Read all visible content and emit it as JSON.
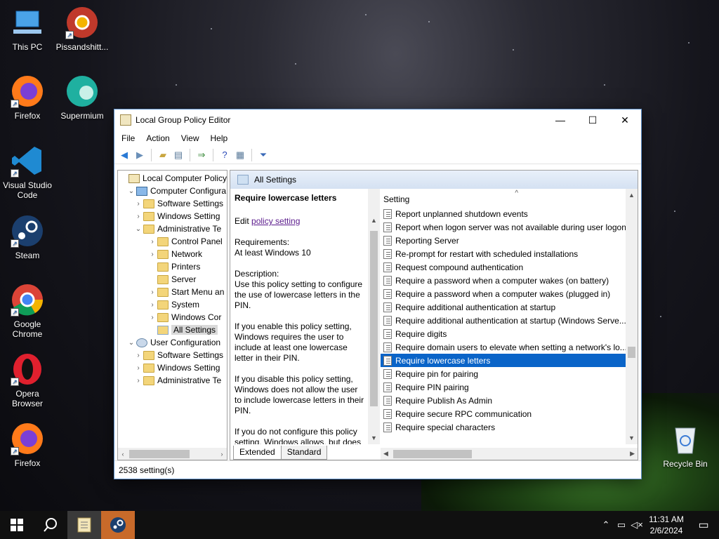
{
  "desktop": {
    "icons": [
      {
        "label": "This PC",
        "icon": "computer-icon"
      },
      {
        "label": "Pissandshitt...",
        "icon": "chrome-canary-icon"
      },
      {
        "label": "Firefox",
        "icon": "firefox-icon"
      },
      {
        "label": "Supermium",
        "icon": "supermium-icon"
      },
      {
        "label": "Visual Studio Code",
        "icon": "vscode-icon"
      },
      {
        "label": "Steam",
        "icon": "steam-icon"
      },
      {
        "label": "Google Chrome",
        "icon": "chrome-icon"
      },
      {
        "label": "Opera Browser",
        "icon": "opera-icon"
      },
      {
        "label": "Firefox",
        "icon": "firefox-icon"
      },
      {
        "label": "Recycle Bin",
        "icon": "recycle-bin-icon"
      }
    ]
  },
  "window": {
    "title": "Local Group Policy Editor",
    "menu": [
      "File",
      "Action",
      "View",
      "Help"
    ],
    "tree": [
      {
        "label": "Local Computer Policy",
        "arrow": "",
        "icon": "policy"
      },
      {
        "label": "Computer Configura",
        "arrow": "⌄",
        "icon": "computer"
      },
      {
        "label": "Software Settings",
        "arrow": "›",
        "icon": "folder"
      },
      {
        "label": "Windows Setting",
        "arrow": "›",
        "icon": "folder"
      },
      {
        "label": "Administrative Te",
        "arrow": "⌄",
        "icon": "folder"
      },
      {
        "label": "Control Panel",
        "arrow": "›",
        "icon": "folder"
      },
      {
        "label": "Network",
        "arrow": "›",
        "icon": "folder"
      },
      {
        "label": "Printers",
        "arrow": "",
        "icon": "folder"
      },
      {
        "label": "Server",
        "arrow": "",
        "icon": "folder"
      },
      {
        "label": "Start Menu an",
        "arrow": "›",
        "icon": "folder"
      },
      {
        "label": "System",
        "arrow": "›",
        "icon": "folder"
      },
      {
        "label": "Windows Cor",
        "arrow": "›",
        "icon": "folder"
      },
      {
        "label": "All Settings",
        "arrow": "",
        "icon": "settings"
      },
      {
        "label": "User Configuration",
        "arrow": "⌄",
        "icon": "user"
      },
      {
        "label": "Software Settings",
        "arrow": "›",
        "icon": "folder"
      },
      {
        "label": "Windows Setting",
        "arrow": "›",
        "icon": "folder"
      },
      {
        "label": "Administrative Te",
        "arrow": "›",
        "icon": "folder"
      }
    ],
    "header": "All Settings",
    "description": {
      "title": "Require lowercase letters",
      "edit_prefix": "Edit ",
      "edit_link": "policy setting",
      "requirements_label": "Requirements:",
      "requirements_value": "At least Windows 10",
      "description_label": "Description:",
      "p1": "Use this policy setting to configure the use of lowercase letters in the PIN.",
      "p2": "If you enable this policy setting, Windows requires the user to include at least one lowercase letter in their PIN.",
      "p3": "If you disable this policy setting, Windows does not allow the user to include lowercase letters in their PIN.",
      "p4": "If you do not configure this policy setting, Windows allows, but does"
    },
    "list_header": "Setting",
    "settings": [
      "Report unplanned shutdown events",
      "Report when logon server was not available during user logon",
      "Reporting Server",
      "Re-prompt for restart with scheduled installations",
      "Request compound authentication",
      "Require a password when a computer wakes (on battery)",
      "Require a password when a computer wakes (plugged in)",
      "Require additional authentication at startup",
      "Require additional authentication at startup (Windows Serve...",
      "Require digits",
      "Require domain users to elevate when setting a network's lo...",
      "Require lowercase letters",
      "Require pin for pairing",
      "Require PIN pairing",
      "Require Publish As Admin",
      "Require secure RPC communication",
      "Require special characters"
    ],
    "selected_setting": "Require lowercase letters",
    "tabs": [
      "Extended",
      "Standard"
    ],
    "status": "2538 setting(s)"
  },
  "taskbar": {
    "time": "11:31 AM",
    "date": "2/6/2024"
  }
}
